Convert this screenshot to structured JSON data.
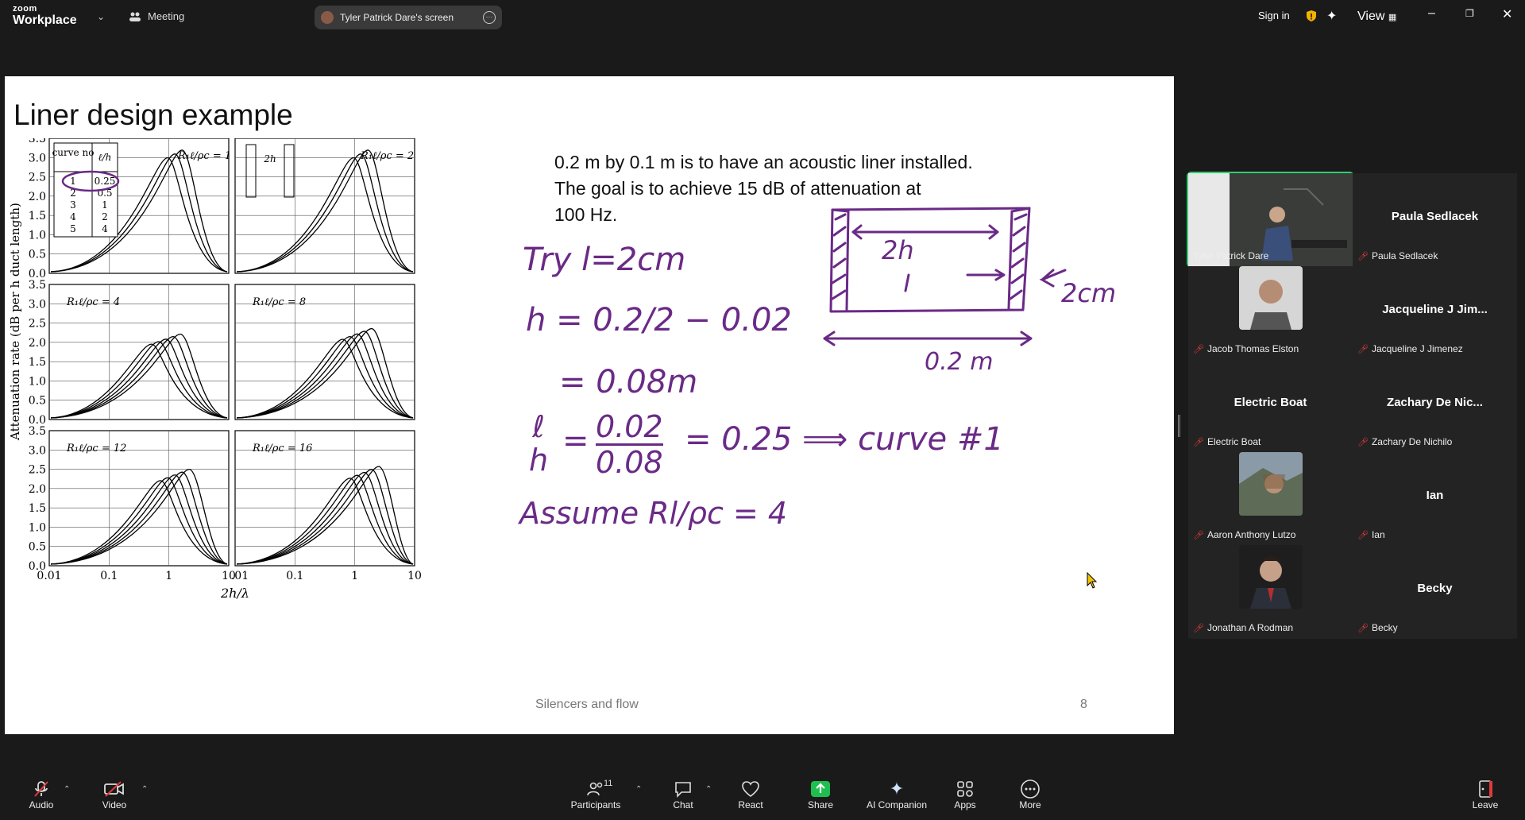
{
  "app": {
    "logo_top": "zoom",
    "logo_bottom": "Workplace",
    "meeting_label": "Meeting",
    "screen_share_label": "Tyler Patrick Dare's screen",
    "sign_in": "Sign in",
    "view": "View"
  },
  "slide": {
    "title": "Liner design example",
    "problem_lines": [
      "0.2 m by 0.1 m is to have an acoustic liner installed.",
      "The goal is to achieve 15 dB of attenuation at",
      "100 Hz."
    ],
    "footer_left": "Silencers and flow",
    "footer_right": "8",
    "handwriting": {
      "try": "Try l=2cm",
      "h_eq": "h = 0.2/2 − 0.02",
      "h_res": "= 0.08m",
      "ratio_num": "0.02",
      "ratio_den": "0.08",
      "ratio_res": "= 0.25  ⟹  curve #1",
      "assume": "Assume  Rl/ρc = 4",
      "dim_2h": "2h",
      "dim_2cm": "2cm",
      "dim_02m": "0.2 m"
    },
    "figure": {
      "ylabel": "Attenuation rate (dB per h duct length)",
      "xlabel": "2h/λ",
      "yticks": [
        "0.0",
        "0.5",
        "1.0",
        "1.5",
        "2.0",
        "2.5",
        "3.0",
        "3.5"
      ],
      "xticks_left": [
        "0.01",
        "0.1",
        "1",
        "10"
      ],
      "xticks_right": [
        ".01",
        "0.1",
        "1",
        "10"
      ],
      "panel_labels": [
        "R₁ℓ/ρc = 1",
        "R₁ℓ/ρc = 2",
        "R₁ℓ/ρc = 4",
        "R₁ℓ/ρc = 8",
        "R₁ℓ/ρc = 12",
        "R₁ℓ/ρc = 16"
      ],
      "table_header": [
        "curve no",
        "ℓ/h"
      ],
      "table_rows": [
        [
          "1",
          "0.25"
        ],
        [
          "2",
          "0.5"
        ],
        [
          "3",
          "1"
        ],
        [
          "4",
          "2"
        ],
        [
          "5",
          "4"
        ]
      ],
      "schematic_label": "2h"
    }
  },
  "participants": [
    {
      "name": "Tyler Patrick Dare",
      "display": "",
      "video": true,
      "active": true
    },
    {
      "name": "Paula Sedlacek",
      "display": "Paula Sedlacek",
      "video": false
    },
    {
      "name": "Jacob Thomas Elston",
      "display": "",
      "video": true
    },
    {
      "name": "Jacqueline J Jimenez",
      "display": "Jacqueline J Jim...",
      "video": false
    },
    {
      "name": "Electric Boat",
      "display": "Electric Boat",
      "video": false
    },
    {
      "name": "Zachary De Nichilo",
      "display": "Zachary De Nic...",
      "video": false
    },
    {
      "name": "Aaron Anthony Lutzo",
      "display": "",
      "video": true
    },
    {
      "name": "Ian",
      "display": "Ian",
      "video": false
    },
    {
      "name": "Jonathan A Rodman",
      "display": "",
      "video": true
    },
    {
      "name": "Becky",
      "display": "Becky",
      "video": false
    }
  ],
  "toolbar": {
    "audio": "Audio",
    "video": "Video",
    "participants": "Participants",
    "participants_count": "11",
    "chat": "Chat",
    "react": "React",
    "share": "Share",
    "ai_companion": "AI Companion",
    "apps": "Apps",
    "more": "More",
    "leave": "Leave"
  },
  "colors": {
    "ink": "#6a2a86",
    "share_green": "#1fbf4f",
    "active_outline": "#2fcf6f",
    "muted_red": "#e03a3a"
  }
}
